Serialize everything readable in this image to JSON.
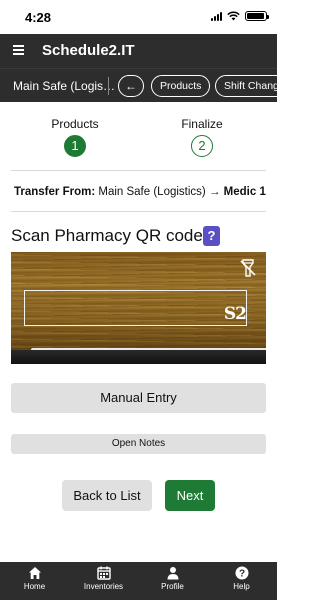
{
  "status_bar": {
    "time": "4:28",
    "battery_level": 0.95
  },
  "header": {
    "title": "Schedule2.IT"
  },
  "subheader": {
    "location": "Main Safe (Logis…",
    "back_arrow": "←",
    "pills": [
      "Products",
      "Shift Change"
    ]
  },
  "steps": [
    {
      "label": "Products",
      "number": "1",
      "state": "active"
    },
    {
      "label": "Finalize",
      "number": "2",
      "state": "pending"
    }
  ],
  "transfer": {
    "prefix": "Transfer From:",
    "from": "Main Safe (Logistics)",
    "arrow": "→",
    "to": "Medic 1"
  },
  "scan": {
    "title": "Scan Pharmacy QR code:",
    "help_label": "?",
    "logo_text": "S2"
  },
  "buttons": {
    "manual_entry": "Manual Entry",
    "open_notes": "Open Notes",
    "back_to_list": "Back to List",
    "next": "Next"
  },
  "bottom_nav": {
    "items": [
      {
        "label": "Home",
        "icon": "home-icon"
      },
      {
        "label": "Inventories",
        "icon": "inventories-icon"
      },
      {
        "label": "Profile",
        "icon": "profile-icon"
      },
      {
        "label": "Help",
        "icon": "help-icon"
      }
    ]
  },
  "colors": {
    "header_bg": "#2d2d2d",
    "accent_green": "#1e7a34",
    "help_purple": "#5b4fc4",
    "button_gray": "#e0e0e0"
  }
}
